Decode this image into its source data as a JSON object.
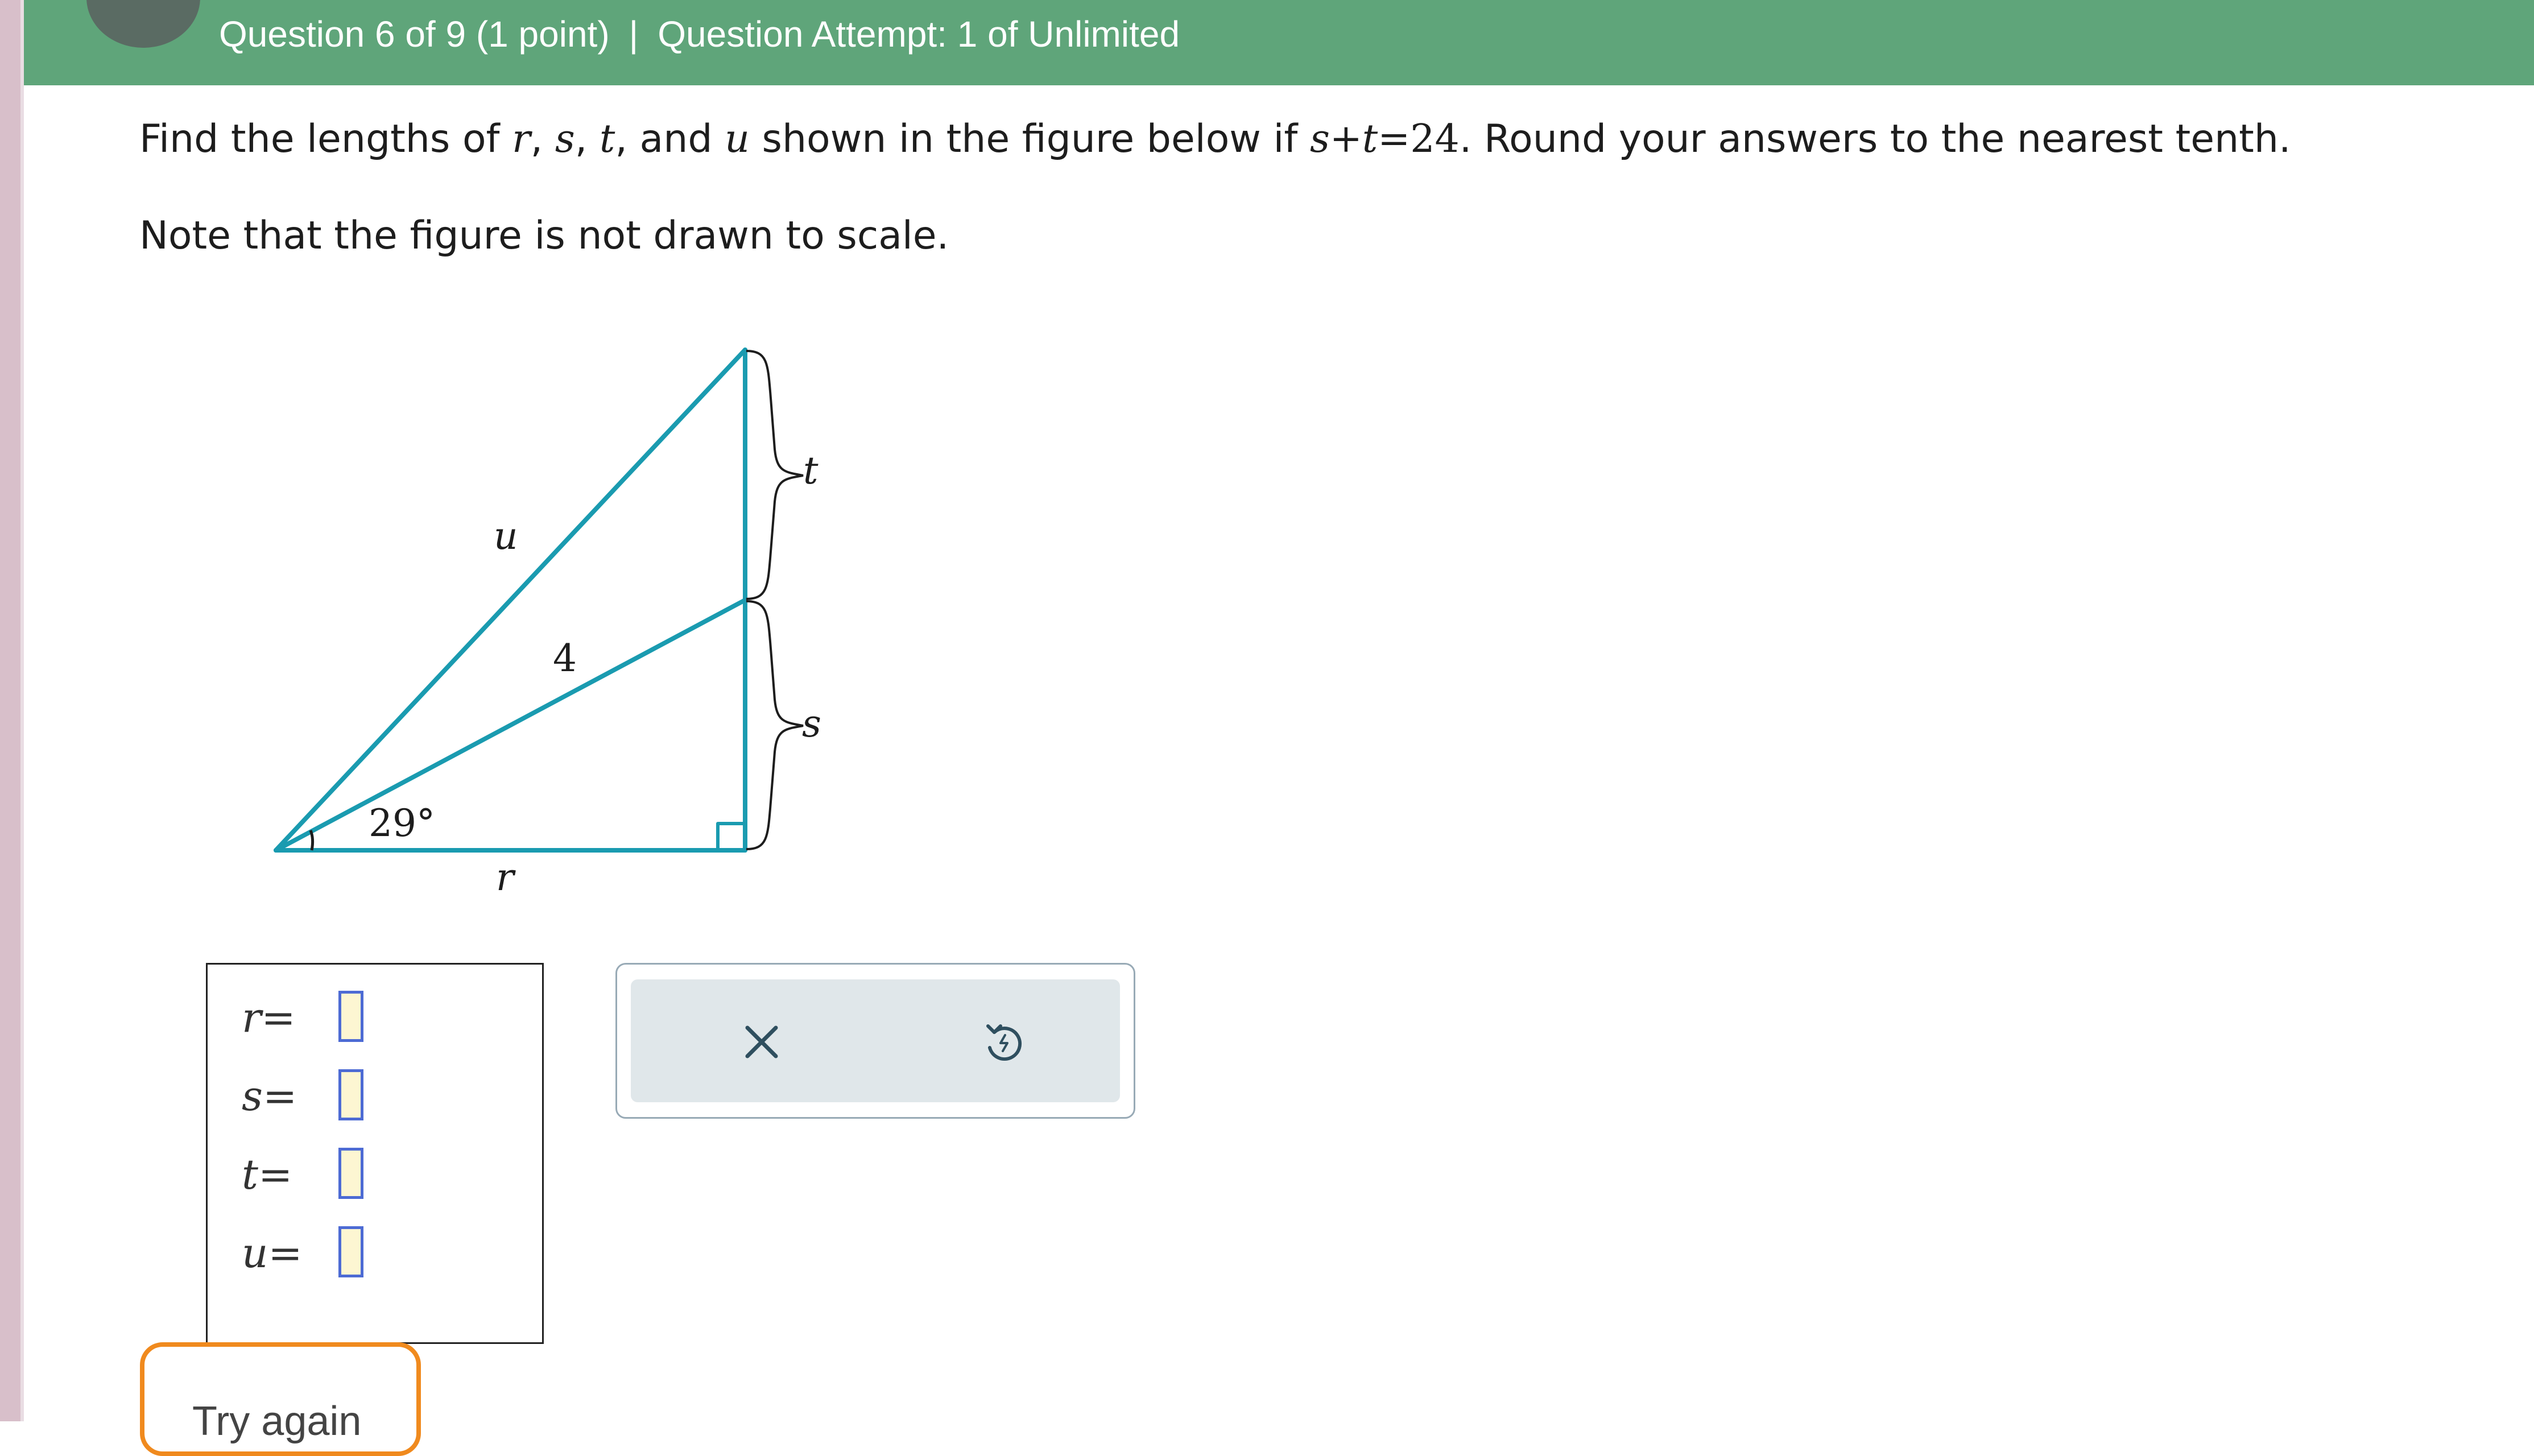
{
  "header": {
    "question_progress": "Question 6 of 9 (1 point)",
    "separator": "|",
    "attempt": "Question Attempt: 1 of Unlimited"
  },
  "question": {
    "t1": "Find the lengths of ",
    "r": "r",
    "comma1": ", ",
    "s": "s",
    "comma2": ", ",
    "t": "t",
    "and": ", and ",
    "u": "u",
    "t2": " shown in the figure below if ",
    "eq_s": "s",
    "eq_plus": "+",
    "eq_t": "t",
    "eq_eq": "=",
    "eq_val": "24",
    "t3": ". Round your answers to the nearest tenth.",
    "note": "Note that the figure is not drawn to scale."
  },
  "figure": {
    "label_u": "u",
    "label_4": "4",
    "label_t": "t",
    "label_s": "s",
    "label_angle": "29°",
    "label_r": "r",
    "line_color": "#1a9bb0"
  },
  "answers": [
    {
      "var": "r",
      "eq": "="
    },
    {
      "var": "s",
      "eq": "="
    },
    {
      "var": "t",
      "eq": "="
    },
    {
      "var": "u",
      "eq": "="
    }
  ],
  "actions": {
    "clear_icon": "close-icon",
    "undo_icon": "undo-icon"
  },
  "try_again_label": "Try again"
}
